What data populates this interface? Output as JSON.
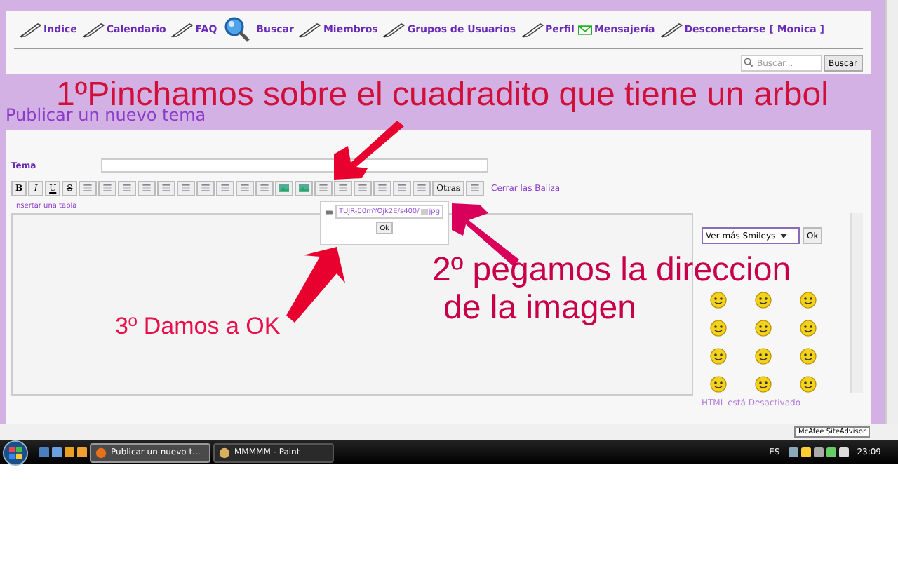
{
  "nav": [
    {
      "label": "Indice",
      "kind": "pen"
    },
    {
      "label": "Calendario",
      "kind": "pen"
    },
    {
      "label": "FAQ",
      "kind": "pen"
    },
    {
      "label": "Buscar",
      "kind": "search"
    },
    {
      "label": "Miembros",
      "kind": "pen"
    },
    {
      "label": "Grupos de Usuarios",
      "kind": "pen"
    },
    {
      "label": "Perfil",
      "kind": "pen"
    },
    {
      "label": "Mensajería",
      "kind": "mail"
    },
    {
      "label": "Desconectarse [ Monica ]",
      "kind": "pen"
    }
  ],
  "search": {
    "placeholder": "Buscar...",
    "button": "Buscar"
  },
  "page_title": "Publicar un nuevo tema",
  "form": {
    "subject_label": "Tema"
  },
  "toolbar": {
    "buttons": [
      {
        "kind": "text",
        "label": "B"
      },
      {
        "kind": "text",
        "label": "I"
      },
      {
        "kind": "text",
        "label": "U"
      },
      {
        "kind": "text",
        "label": "S"
      },
      {
        "kind": "icon"
      },
      {
        "kind": "icon"
      },
      {
        "kind": "icon"
      },
      {
        "kind": "icon"
      },
      {
        "kind": "icon"
      },
      {
        "kind": "icon"
      },
      {
        "kind": "icon"
      },
      {
        "kind": "icon"
      },
      {
        "kind": "icon"
      },
      {
        "kind": "icon"
      },
      {
        "kind": "image"
      },
      {
        "kind": "image"
      },
      {
        "kind": "icon"
      },
      {
        "kind": "icon"
      },
      {
        "kind": "icon"
      },
      {
        "kind": "icon"
      },
      {
        "kind": "icon"
      },
      {
        "kind": "icon"
      },
      {
        "kind": "text",
        "label": "Otras"
      },
      {
        "kind": "icon"
      }
    ],
    "close_tags": "Cerrar las Baliza"
  },
  "hint": "Insertar una tabla",
  "image_popup": {
    "value_start": "TUJR-00mYOjk2E/s400/",
    "value_end": "jpg",
    "button": "Ok"
  },
  "smileys": {
    "select": "Ver más Smileys",
    "button": "Ok",
    "html_status": "HTML está Desactivado"
  },
  "addon": "McAfee SiteAdvisor",
  "taskbar": {
    "windows": [
      {
        "label": "Publicar un nuevo t...",
        "selected": true
      },
      {
        "label": "MMMMM - Paint",
        "selected": false
      }
    ],
    "lang": "ES",
    "clock": "23:09"
  },
  "annotations": [
    {
      "text": "1ºPinchamos sobre el cuadradito que tiene un arbol",
      "kind": "step1"
    },
    {
      "text": "2º pegamos la direccion",
      "kind": "step2"
    },
    {
      "text": "de la imagen",
      "kind": "step2b"
    },
    {
      "text": "3º Damos a OK",
      "kind": "step3"
    }
  ]
}
